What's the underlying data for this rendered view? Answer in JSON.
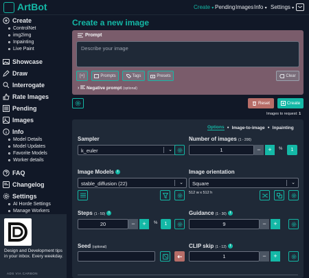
{
  "header": {
    "brand": "ArtBot",
    "nav": [
      {
        "label": "Create",
        "active": true,
        "caret": "▾"
      },
      {
        "label": "Pending",
        "active": false
      },
      {
        "label": "Images",
        "active": false
      },
      {
        "label": "Info",
        "active": false,
        "caret": "▾"
      },
      {
        "label": "Settings",
        "active": false,
        "caret": "▾"
      }
    ]
  },
  "sidebar": {
    "create": "Create",
    "create_items": [
      "ControlNet",
      "img2img",
      "Inpainting",
      "Live Paint"
    ],
    "showcase": "Showcase",
    "draw": "Draw",
    "interrogate": "Interrogate",
    "rate": "Rate Images",
    "pending": "Pending",
    "images": "Images",
    "info": "Info",
    "info_items": [
      "Model Details",
      "Model Updates",
      "Favorite Models",
      "Worker details"
    ],
    "faq": "FAQ",
    "changelog": "Changelog",
    "settings": "Settings",
    "settings_items": [
      "AI Horde Settings",
      "Manage Workers"
    ],
    "ad": {
      "text": "Design and Development tips in your inbox. Every weekday.",
      "via": "ADS VIA CARBON"
    }
  },
  "main": {
    "title": "Create a new image",
    "prompt": {
      "label": "Prompt",
      "placeholder": "Describe your image",
      "buttons": {
        "brackets": "[+]",
        "prompts": "Prompts",
        "tags": "Tags",
        "presets": "Presets",
        "clear": "Clear"
      },
      "negative_label": "Negative prompt",
      "negative_optional": "(optional)"
    },
    "actions": {
      "reset": "Reset",
      "create": "Create"
    },
    "images_to_request": {
      "label": "Images to request:",
      "value": "1"
    },
    "tabs": [
      {
        "label": "Options",
        "active": true
      },
      {
        "label": "Image-to-image",
        "active": false
      },
      {
        "label": "Inpainting",
        "active": false
      }
    ],
    "sampler": {
      "label": "Sampler",
      "value": "k_euler"
    },
    "num_images": {
      "label": "Number of images",
      "range": "(1 - 200)",
      "value": "1",
      "multiplier": "1"
    },
    "image_models": {
      "label": "Image Models",
      "value": "stable_diffusion (22)"
    },
    "orientation": {
      "label": "Image orientation",
      "value": "Square",
      "dims": "512 w x 512 h"
    },
    "steps": {
      "label": "Steps",
      "range": "(1 - 50)",
      "value": "20",
      "multiplier": "1"
    },
    "guidance": {
      "label": "Guidance",
      "range": "(1 - 30)",
      "value": "9"
    },
    "seed": {
      "label": "Seed",
      "optional": "(optional)",
      "value": ""
    },
    "clip_skip": {
      "label": "CLIP skip",
      "range": "(1 - 12)",
      "value": "1"
    },
    "percent_sign": "%",
    "info_glyph": "i",
    "plus": "+",
    "minus": "−"
  },
  "colors": {
    "accent": "#14b8a6",
    "prompt_bg": "#7a5c6b",
    "reset": "#b76d68",
    "bg": "#111827",
    "panel": "#1f2937"
  }
}
